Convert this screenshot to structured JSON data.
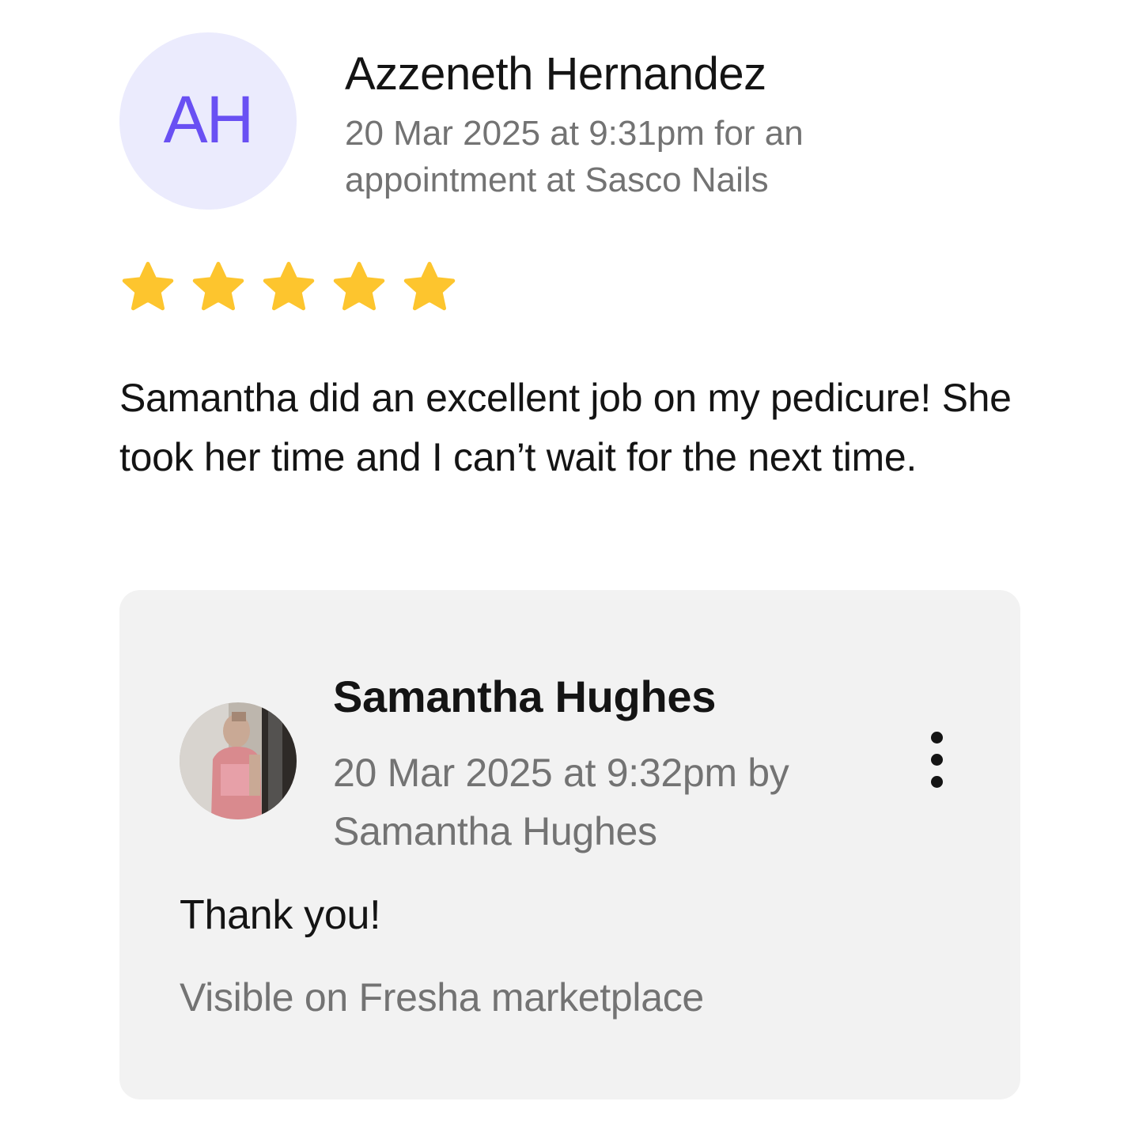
{
  "review": {
    "avatar_initials": "AH",
    "reviewer_name": "Azzeneth Hernandez",
    "meta": "20 Mar 2025 at 9:31pm for an appointment at Sasco Nails",
    "rating": 5,
    "rating_max": 5,
    "text": "Samantha did an excellent job on my pedicure!  She took her time and I can’t wait for the next time."
  },
  "reply": {
    "author_name": "Samantha Hughes",
    "meta": "20 Mar 2025 at 9:32pm by Samantha Hughes",
    "text": "Thank you!",
    "visibility": "Visible on Fresha marketplace"
  },
  "colors": {
    "accent": "#6950f3",
    "avatar_bg": "#ebebfd",
    "star": "#fdc52e",
    "card_bg": "#f2f2f2",
    "muted_text": "#737373",
    "text": "#141414"
  },
  "icons": {
    "star": "star-icon",
    "more": "more-vertical-icon"
  }
}
